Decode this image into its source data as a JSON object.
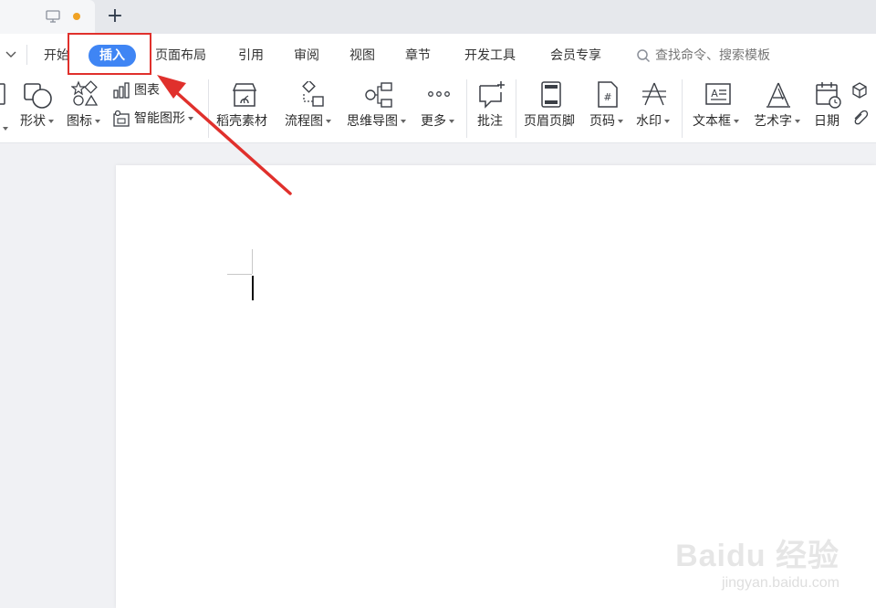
{
  "menu": {
    "items": [
      {
        "label": "开始"
      },
      {
        "label": "插入"
      },
      {
        "label": "页面布局"
      },
      {
        "label": "引用"
      },
      {
        "label": "审阅"
      },
      {
        "label": "视图"
      },
      {
        "label": "章节"
      },
      {
        "label": "开发工具"
      },
      {
        "label": "会员专享"
      }
    ],
    "search_placeholder": "查找命令、搜索模板"
  },
  "toolbar": {
    "shape": "形状",
    "icon": "图标",
    "chart": "图表",
    "smartart": "智能图形",
    "material": "稻壳素材",
    "flowchart": "流程图",
    "mindmap": "思维导图",
    "more": "更多",
    "comment": "批注",
    "header_footer": "页眉页脚",
    "page_number": "页码",
    "watermark": "水印",
    "textbox": "文本框",
    "wordart": "艺术字",
    "date": "日期"
  },
  "watermark_text": {
    "big": "Baidu 经验",
    "small": "jingyan.baidu.com"
  },
  "colors": {
    "accent": "#3f85f4",
    "highlight": "#e0302c",
    "unsaved_dot": "#f0a224"
  }
}
